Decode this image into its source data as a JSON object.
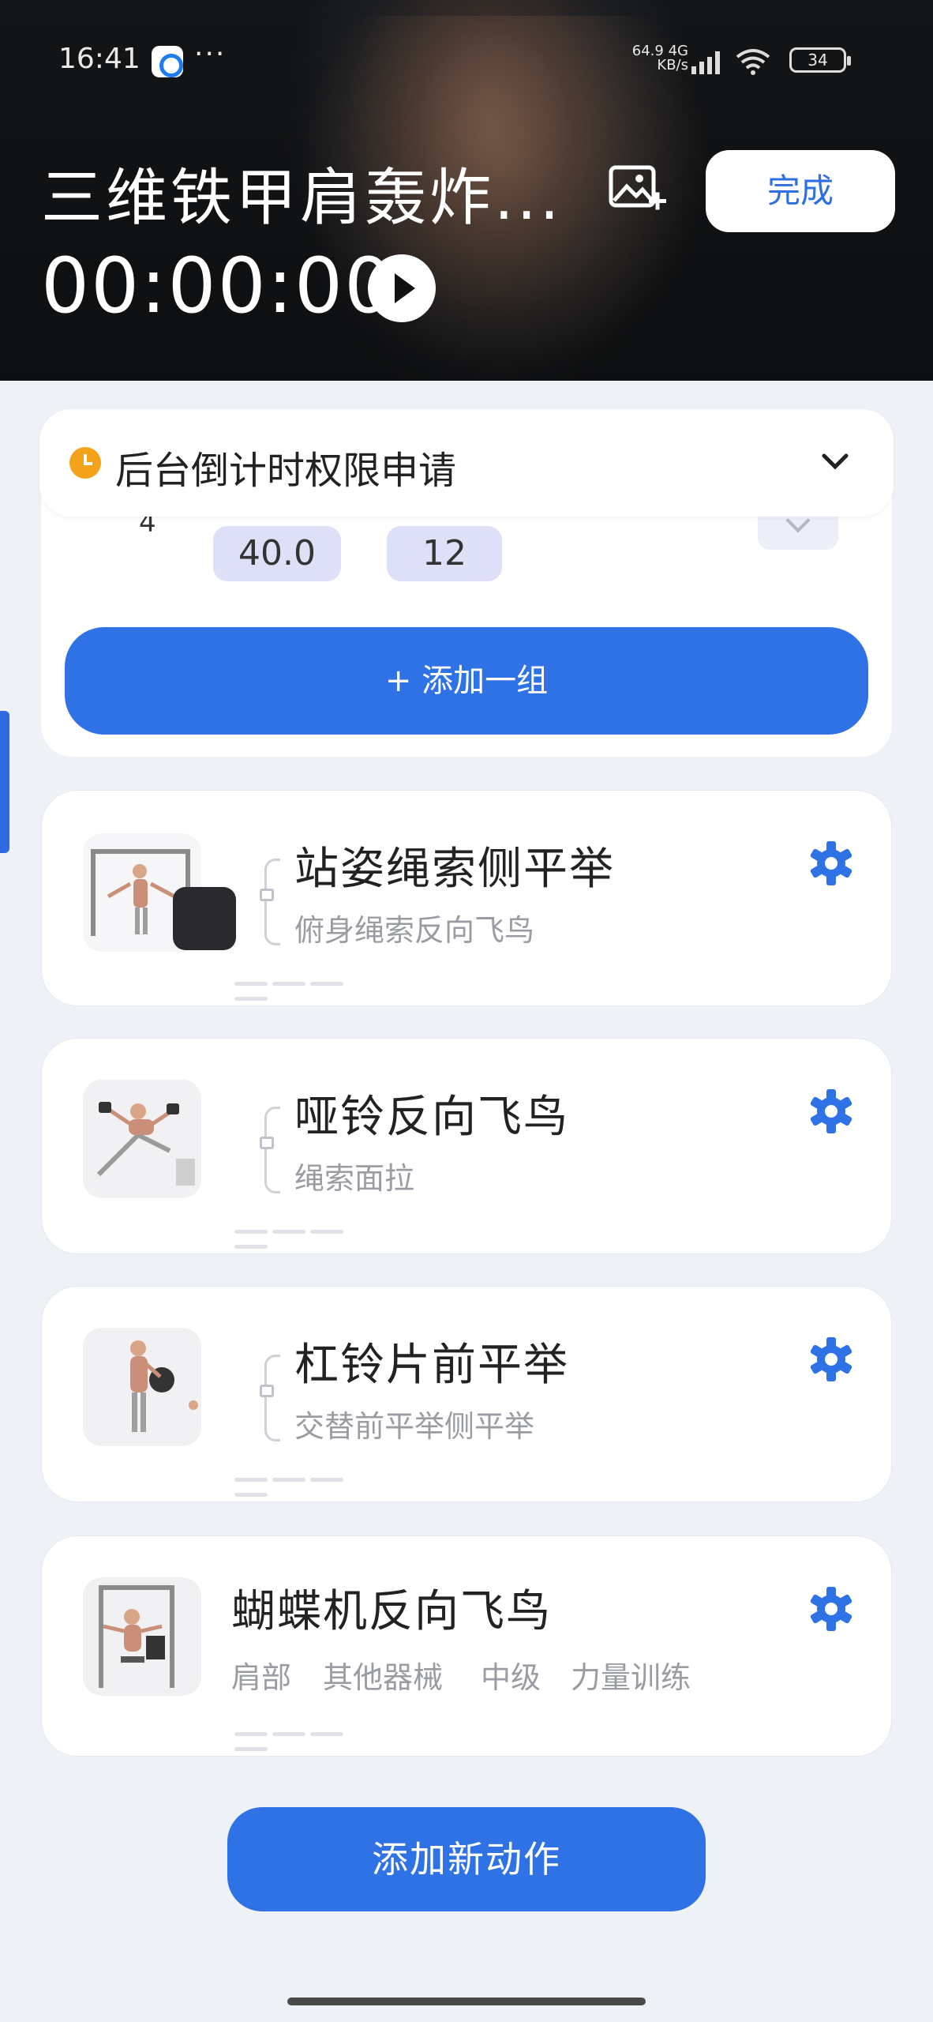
{
  "status_bar": {
    "time": "16:41",
    "dots": "···",
    "net_speed": "64.9",
    "net_unit": "KB/s",
    "network": "4G",
    "battery": "34"
  },
  "header": {
    "title": "三维铁甲肩轰炸...",
    "done_label": "完成",
    "timer": "00:00:00"
  },
  "permission": {
    "text": "后台倒计时权限申请",
    "icon": "clock-icon",
    "icon_color": "#f5a21b"
  },
  "set_row": {
    "index": "4",
    "weight": "40.0",
    "reps": "12"
  },
  "add_set_label": "+ 添加一组",
  "exercises": [
    {
      "name": "站姿绳索侧平举",
      "subtitle": "俯身绳索反向飞鸟"
    },
    {
      "name": "哑铃反向飞鸟",
      "subtitle": "绳索面拉"
    },
    {
      "name": "杠铃片前平举",
      "subtitle": "交替前平举侧平举"
    },
    {
      "name": "蝴蝶机反向飞鸟",
      "tags": [
        "肩部",
        "其他器械",
        "中级",
        "力量训练"
      ]
    }
  ],
  "add_exercise_label": "添加新动作",
  "colors": {
    "accent": "#2f72e6",
    "pill": "#dde0f7",
    "warning": "#f5a21b"
  }
}
